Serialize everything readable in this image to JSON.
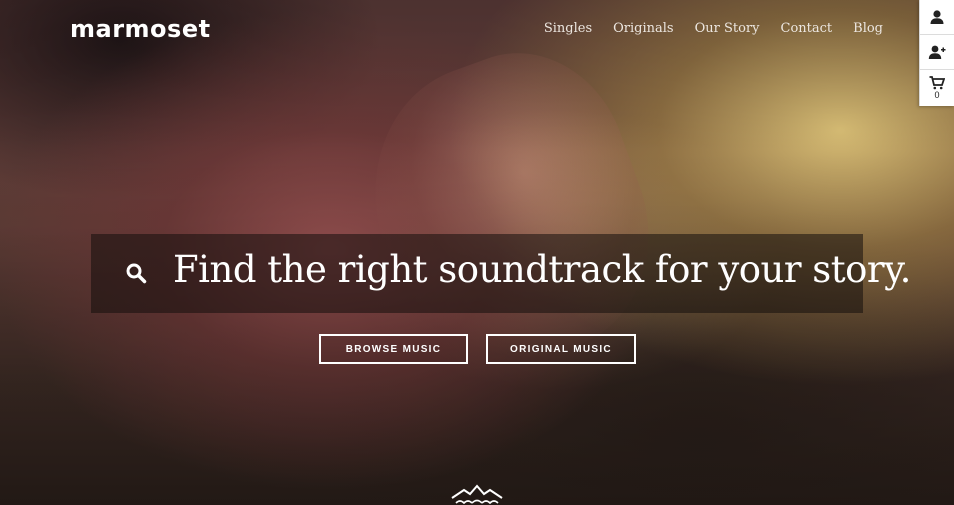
{
  "brand": {
    "logo_text": "marmoset"
  },
  "nav": {
    "items": [
      {
        "label": "Singles"
      },
      {
        "label": "Originals"
      },
      {
        "label": "Our Story"
      },
      {
        "label": "Contact"
      },
      {
        "label": "Blog"
      }
    ]
  },
  "side_tools": {
    "account_icon": "user-icon",
    "signup_icon": "add-user-icon",
    "cart_icon": "cart-icon",
    "cart_count": "0"
  },
  "hero": {
    "search_icon": "search-icon",
    "search_text": "Find the right soundtrack for your story.",
    "buttons": {
      "browse_label": "BROWSE MUSIC",
      "original_label": "ORIGINAL MUSIC"
    },
    "footer_icon": "mountain-logo-icon"
  },
  "colors": {
    "text": "#ffffff",
    "search_bg": "rgba(20,14,12,0.55)",
    "toolbar_bg": "#ffffff"
  }
}
